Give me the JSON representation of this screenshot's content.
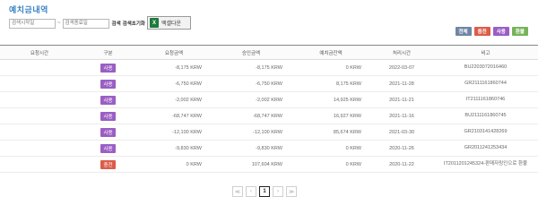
{
  "page_title": "예치금내역",
  "filter": {
    "start_placeholder": "검색시작일",
    "end_placeholder": "검색종료일",
    "separator": "~",
    "search_label": "검색",
    "reset_label": "검색초기화",
    "excel_label": "엑셀다운",
    "excel_icon": "X"
  },
  "type_filters": [
    {
      "label": "전체",
      "color": "#6e86a3"
    },
    {
      "label": "충전",
      "color": "#dc5c48"
    },
    {
      "label": "사용",
      "color": "#9a5ec4"
    },
    {
      "label": "환불",
      "color": "#75b458"
    }
  ],
  "table": {
    "headers": [
      "요청시간",
      "구분",
      "요청금액",
      "승인금액",
      "예치금잔액",
      "처리시간",
      "비고"
    ],
    "rows": [
      {
        "requested": "",
        "type": "사용",
        "type_color": "#9a5ec4",
        "request_amount": "-8,175 KRW",
        "approved_amount": "-8,175 KRW",
        "balance": "0 KRW",
        "processed": "2022-03-07",
        "memo": "BU2203072016460"
      },
      {
        "requested": "",
        "type": "사용",
        "type_color": "#9a5ec4",
        "request_amount": "-6,750 KRW",
        "approved_amount": "-6,750 KRW",
        "balance": "8,175 KRW",
        "processed": "2021-11-28",
        "memo": "GR2111161860744"
      },
      {
        "requested": "",
        "type": "사용",
        "type_color": "#9a5ec4",
        "request_amount": "-2,002 KRW",
        "approved_amount": "-2,002 KRW",
        "balance": "14,925 KRW",
        "processed": "2021-11-21",
        "memo": "IT2111161860746"
      },
      {
        "requested": "",
        "type": "사용",
        "type_color": "#9a5ec4",
        "request_amount": "-68,747 KRW",
        "approved_amount": "-68,747 KRW",
        "balance": "16,927 KRW",
        "processed": "2021-11-16",
        "memo": "BU2111161860745"
      },
      {
        "requested": "",
        "type": "사용",
        "type_color": "#9a5ec4",
        "request_amount": "-12,100 KRW",
        "approved_amount": "-12,100 KRW",
        "balance": "85,674 KRW",
        "processed": "2021-03-30",
        "memo": "GR2103141428269"
      },
      {
        "requested": "",
        "type": "사용",
        "type_color": "#9a5ec4",
        "request_amount": "-9,830 KRW",
        "approved_amount": "-9,830 KRW",
        "balance": "0 KRW",
        "processed": "2020-11-26",
        "memo": "GR2011241253434"
      },
      {
        "requested": "",
        "type": "충전",
        "type_color": "#dc5c48",
        "request_amount": "0 KRW",
        "approved_amount": "107,604 KRW",
        "balance": "0 KRW",
        "processed": "2020-11-22",
        "memo": "IT2011201245324-판매자링인으로 환불"
      }
    ]
  },
  "pagination": {
    "first": "≪",
    "prev": "‹",
    "current": "1",
    "next": "›",
    "last": "≫"
  }
}
